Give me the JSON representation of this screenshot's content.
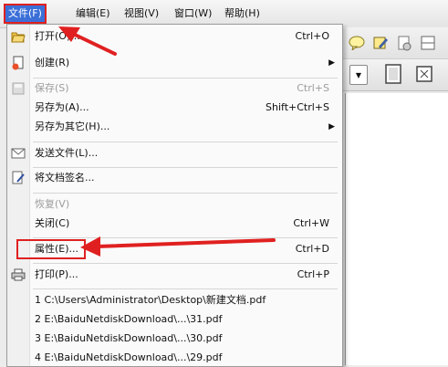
{
  "menubar": {
    "file": "文件(F)",
    "edit": "编辑(E)",
    "view": "视图(V)",
    "window": "窗口(W)",
    "help": "帮助(H)"
  },
  "file_menu": {
    "open": {
      "label": "打开(O)...",
      "shortcut": "Ctrl+O"
    },
    "create": {
      "label": "创建(R)"
    },
    "save": {
      "label": "保存(S)",
      "shortcut": "Ctrl+S"
    },
    "save_as": {
      "label": "另存为(A)...",
      "shortcut": "Shift+Ctrl+S"
    },
    "save_as_other": {
      "label": "另存为其它(H)..."
    },
    "send_file": {
      "label": "发送文件(L)..."
    },
    "sign": {
      "label": "将文档签名..."
    },
    "revert": {
      "label": "恢复(V)"
    },
    "close": {
      "label": "关闭(C)",
      "shortcut": "Ctrl+W"
    },
    "properties": {
      "label": "属性(E)...",
      "shortcut": "Ctrl+D"
    },
    "print": {
      "label": "打印(P)...",
      "shortcut": "Ctrl+P"
    },
    "recent": [
      "1 C:\\Users\\Administrator\\Desktop\\新建文档.pdf",
      "2 E:\\BaiduNetdiskDownload\\...\\31.pdf",
      "3 E:\\BaiduNetdiskDownload\\...\\30.pdf",
      "4 E:\\BaiduNetdiskDownload\\...\\29.pdf"
    ]
  },
  "colors": {
    "highlight_red": "#e02020",
    "menu_selected": "#3b6fd8"
  },
  "icons": [
    "open-folder-icon",
    "create-icon",
    "save-icon",
    "email-icon",
    "sign-document-icon",
    "print-icon",
    "comment-icon",
    "highlight-pen-icon",
    "stamp-icon",
    "page-layout-icon"
  ]
}
